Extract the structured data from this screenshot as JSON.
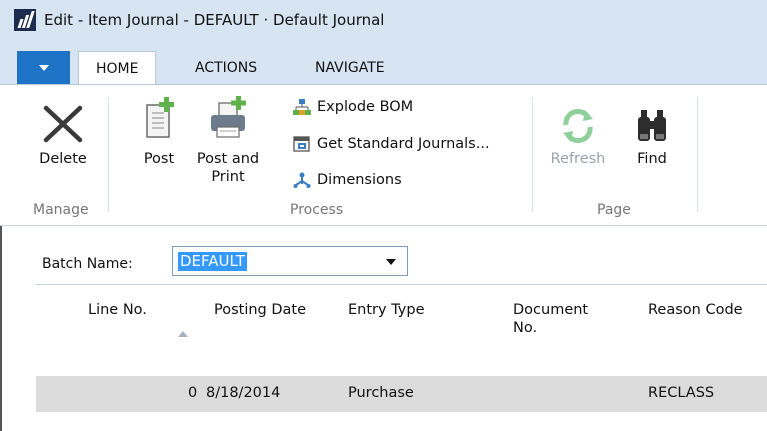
{
  "window": {
    "title": "Edit - Item Journal - DEFAULT · Default Journal"
  },
  "tabs": [
    {
      "label": "HOME",
      "active": true
    },
    {
      "label": "ACTIONS",
      "active": false
    },
    {
      "label": "NAVIGATE",
      "active": false
    }
  ],
  "ribbon": {
    "manage": {
      "group_label": "Manage",
      "delete_label": "Delete"
    },
    "process": {
      "group_label": "Process",
      "post_label": "Post",
      "post_print_label_line1": "Post and",
      "post_print_label_line2": "Print",
      "explode_bom_label": "Explode BOM",
      "get_standard_journals_label": "Get Standard Journals...",
      "dimensions_label": "Dimensions"
    },
    "page": {
      "group_label": "Page",
      "refresh_label": "Refresh",
      "find_label": "Find"
    }
  },
  "batch": {
    "label": "Batch Name:",
    "value": "DEFAULT"
  },
  "grid": {
    "columns": [
      {
        "line1": "Line No.",
        "line2": ""
      },
      {
        "line1": "Posting Date",
        "line2": ""
      },
      {
        "line1": "Entry Type",
        "line2": ""
      },
      {
        "line1": "Document",
        "line2": "No."
      },
      {
        "line1": "Reason Code",
        "line2": ""
      }
    ],
    "rows": [
      {
        "line_no": "0",
        "posting_date": "8/18/2014",
        "entry_type": "Purchase",
        "document_no": "",
        "reason_code": "RECLASS"
      }
    ]
  },
  "colors": {
    "accent": "#1f73c6",
    "selection": "#3399ff",
    "plus_green": "#5fb14a"
  },
  "icons": [
    "app-logo-icon",
    "app-menu-icon",
    "delete-icon",
    "post-icon",
    "post-and-print-icon",
    "explode-bom-icon",
    "get-standard-journals-icon",
    "dimensions-icon",
    "refresh-icon",
    "find-icon",
    "dropdown-caret-icon",
    "sort-ascending-icon"
  ]
}
